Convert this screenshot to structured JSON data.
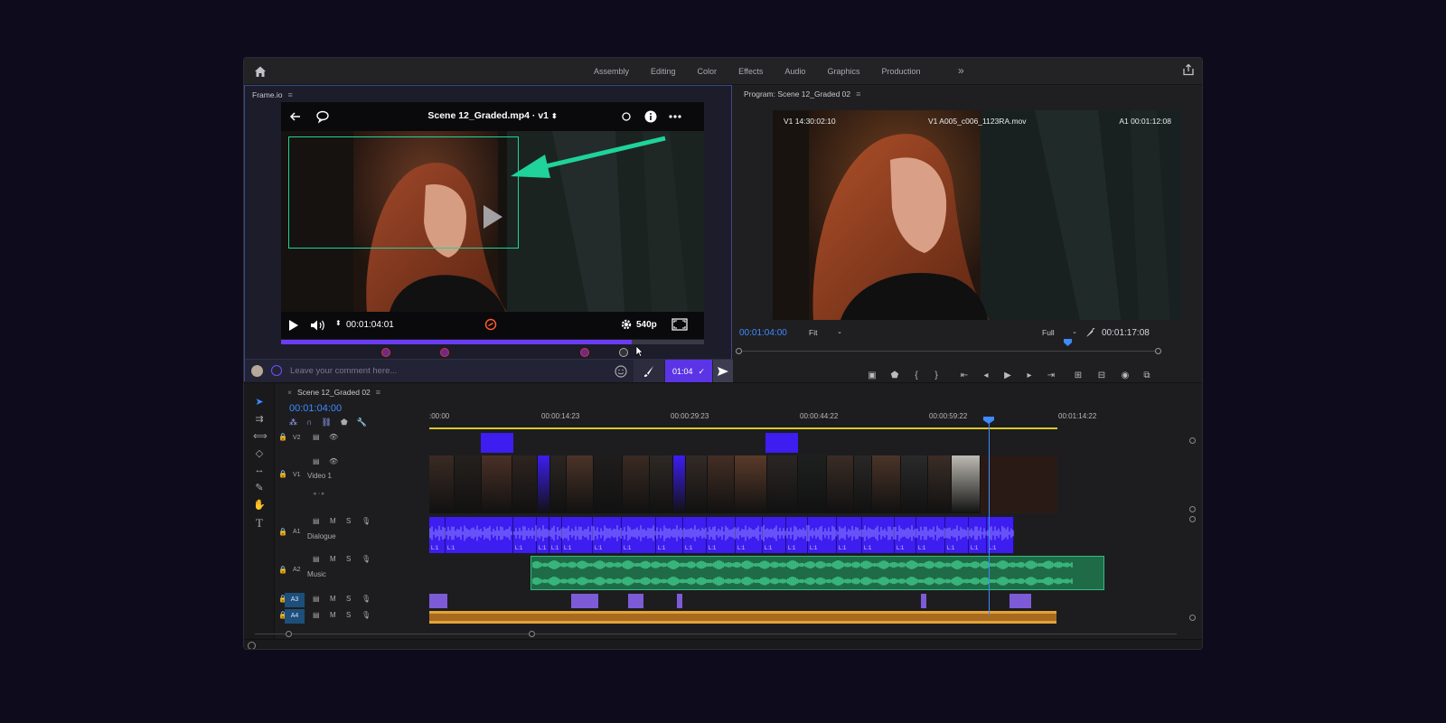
{
  "workspaces": [
    "Assembly",
    "Editing",
    "Color",
    "Effects",
    "Audio",
    "Graphics",
    "Production"
  ],
  "frameio": {
    "panel_title": "Frame.io",
    "player_title": "Scene 12_Graded.mp4 · v1",
    "timecode": "00:01:04:01",
    "quality": "540p",
    "progress": 0.83,
    "comment_placeholder": "Leave your comment here...",
    "comment_time": "01:04"
  },
  "program": {
    "panel_title": "Program: Scene 12_Graded 02",
    "overlay_left": "V1 14:30:02:10",
    "overlay_center": "V1 A005_c006_1123RA.mov",
    "overlay_right": "A1 00:01:12:08",
    "current_tc": "00:01:04:00",
    "zoom": "Fit",
    "resolution": "Full",
    "duration_tc": "00:01:17:08"
  },
  "timeline": {
    "sequence_name": "Scene 12_Graded 02",
    "current_tc": "00:01:04:00",
    "ruler": [
      ":00:00",
      "00:00:14:23",
      "00:00:29:23",
      "00:00:44:22",
      "00:00:59:22",
      "00:01:14:22"
    ],
    "tracks": {
      "v2": "V2",
      "v1": "V1",
      "v1_name": "Video 1",
      "a1": "A1",
      "a1_name": "Dialogue",
      "a2": "A2",
      "a2_name": "Music",
      "a3": "A3",
      "a4": "A4",
      "m": "M",
      "s": "S",
      "l1": "L:1"
    }
  },
  "colors": {
    "accent": "#5b34e6",
    "timecode": "#3d8bff",
    "annotation": "#1fd39a",
    "music": "#2fbf7a",
    "dialogue": "#3d1df0",
    "a4_clip": "#d9962a"
  }
}
